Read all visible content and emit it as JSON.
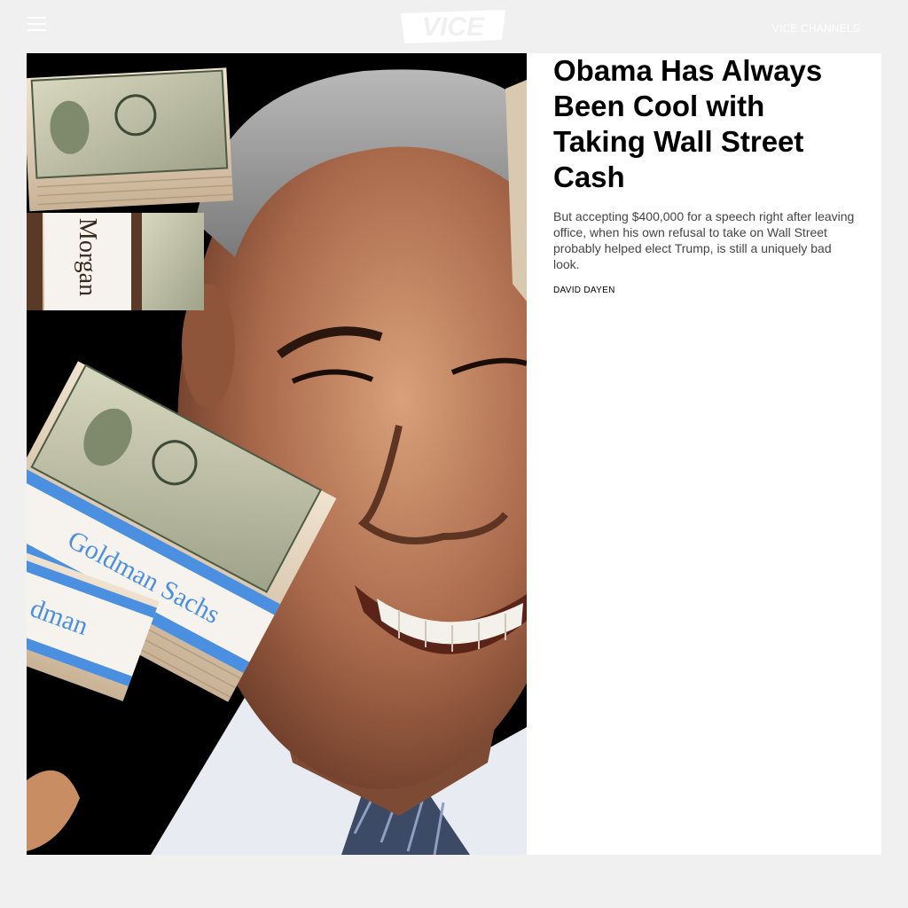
{
  "header": {
    "logo_text": "VICE",
    "channels_label": "VICE CHANNELS",
    "menu_icon": "hamburger-menu-icon"
  },
  "article": {
    "headline": "Obama Has Always Been Cool with Taking Wall Street Cash",
    "dek": "But accepting $400,000 for a speech right after leaving office, when his own refusal to take on Wall Street probably helped elect Trump, is still a uniquely bad look.",
    "byline": "DAVID DAYEN",
    "image": {
      "band_texts": [
        "Morgan",
        "Goldman Sachs",
        "dman"
      ]
    }
  },
  "colors": {
    "page_bg": "#f0f0f0",
    "card_bg": "#ffffff",
    "headline": "#000000",
    "dek": "#444444",
    "band_blue": "#4b8fe0"
  }
}
